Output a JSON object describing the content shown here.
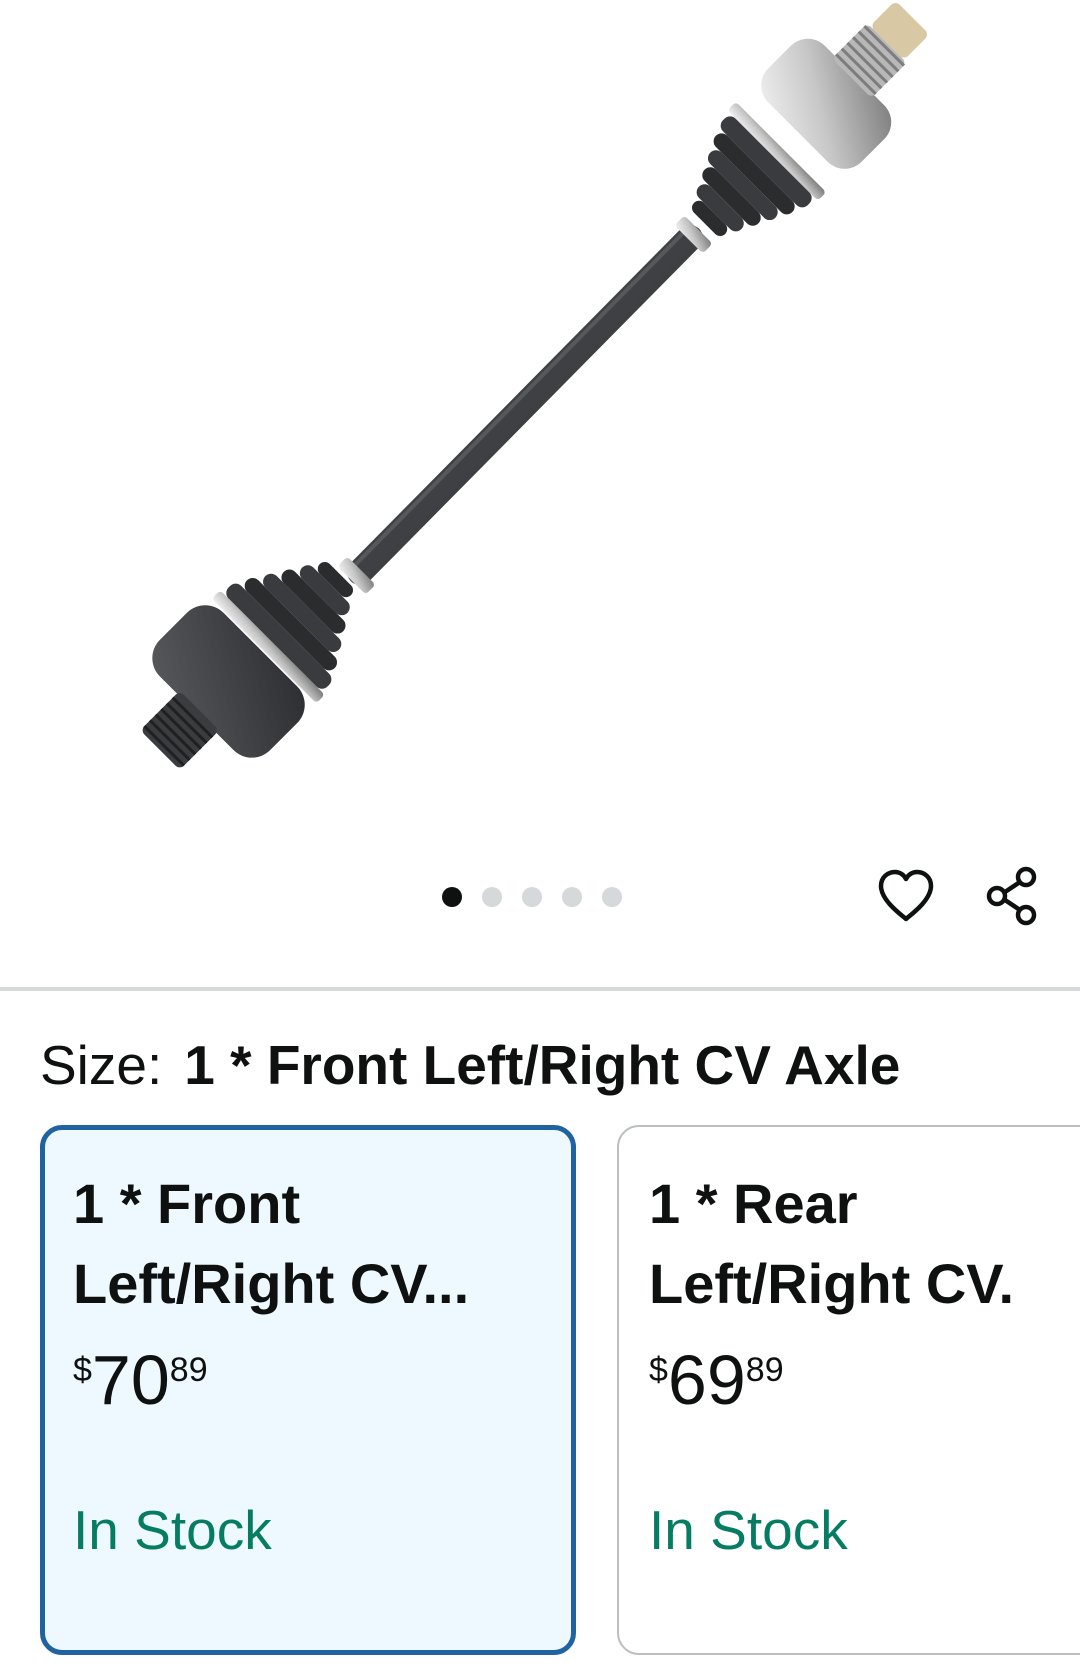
{
  "gallery": {
    "image_icon": "cv-axle-product-image",
    "dot_count": 5,
    "active_dot_index": 0,
    "wishlist_icon": "heart-icon",
    "share_icon": "share-icon"
  },
  "size_selector": {
    "label": "Size:",
    "selected_value": "1 * Front Left/Right CV Axle"
  },
  "options": [
    {
      "title": "1 * Front\nLeft/Right CV...",
      "price_symbol": "$",
      "price_whole": "70",
      "price_fraction": "89",
      "availability": "In Stock",
      "selected": true
    },
    {
      "title": "1 * Rear\nLeft/Right CV.",
      "price_symbol": "$",
      "price_whole": "69",
      "price_fraction": "89",
      "availability": "In Stock",
      "selected": false
    }
  ],
  "colors": {
    "selected_border": "#2162a1",
    "selected_bg": "#edf8ff",
    "in_stock": "#067d62",
    "divider": "#d5d9d9"
  }
}
